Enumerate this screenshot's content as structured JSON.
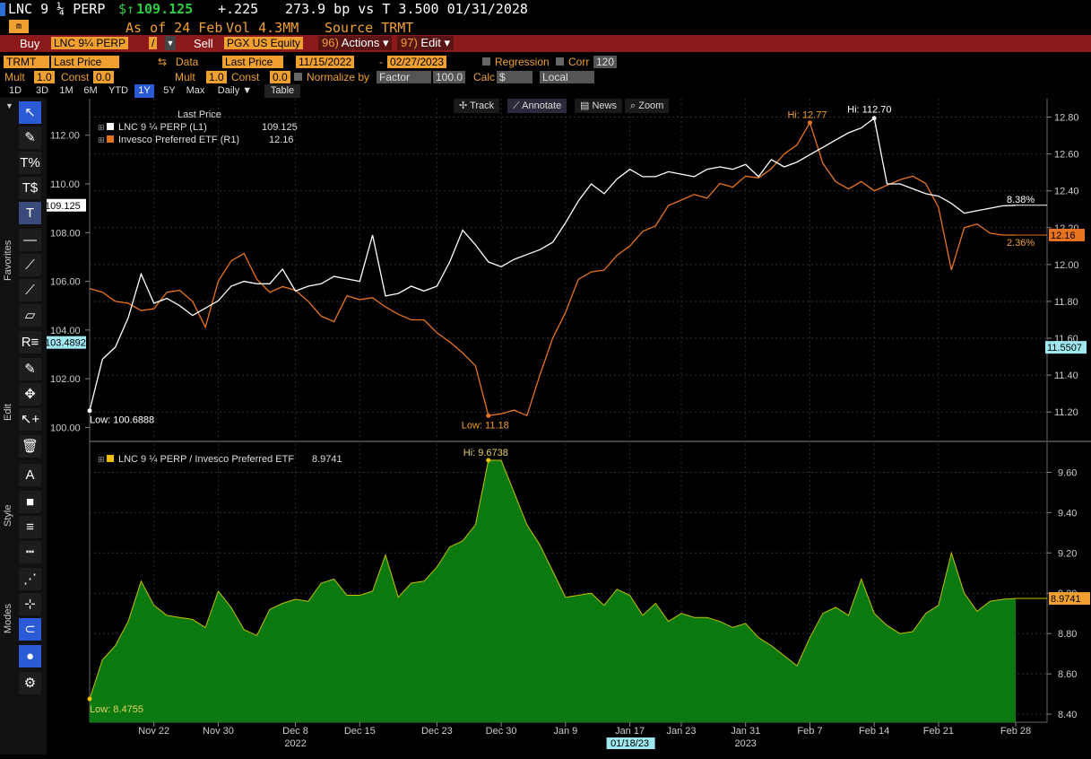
{
  "header": {
    "ticker": "LNC 9 ¼ PERP",
    "currency_symbol": "$",
    "up_arrow": "↑",
    "price": "109.125",
    "change": "+.225",
    "spread": "273.9 bp vs T 3.500 01/31/2028",
    "as_of": "As of 24 Feb",
    "volume": "Vol 4.3MM",
    "source": "Source TRMT"
  },
  "action_bar": {
    "buy_label": "Buy",
    "buy_ticker": "LNC 9¼ PERP",
    "slash": "/",
    "sell_label": "Sell",
    "sell_ticker": "PGX US Equity",
    "actions_num": "96)",
    "actions_label": "Actions",
    "edit_num": "97)",
    "edit_label": "Edit"
  },
  "controls": {
    "source_field": "TRMT",
    "series_field": "Last Price",
    "data_label": "Data",
    "data_field": "Last Price",
    "start_date": "11/15/2022",
    "dash": "-",
    "end_date": "02/27/2023",
    "regression_label": "Regression",
    "corr_label": "Corr",
    "corr_value": "120",
    "mult_label": "Mult",
    "mult_value": "1.0",
    "const_label": "Const",
    "const_value": "0.0",
    "mult2_label": "Mult",
    "mult2_value": "1.0",
    "const2_label": "Const",
    "const2_value": "0.0",
    "normalize_label": "Normalize by",
    "normalize_field": "Factor",
    "normalize_value": "100.0",
    "calc_label": "Calc",
    "calc_field": "$",
    "local_field": "Local"
  },
  "period_tabs": [
    "1D",
    "3D",
    "1M",
    "6M",
    "YTD",
    "1Y",
    "5Y",
    "Max",
    "Daily ▼",
    "Table"
  ],
  "active_tab": "1Y",
  "chart_tools": [
    "Track",
    "Annotate",
    "News",
    "Zoom"
  ],
  "sidebar_labels": {
    "favorites": "Favorites",
    "edit": "Edit",
    "style": "Style",
    "modes": "Modes"
  },
  "sidebar_tools": [
    {
      "name": "cursor-icon",
      "glyph": "↖"
    },
    {
      "name": "pencil-line-icon",
      "glyph": "✎"
    },
    {
      "name": "percent-tool-icon",
      "glyph": "T%"
    },
    {
      "name": "dollar-tool-icon",
      "glyph": "T$"
    },
    {
      "name": "text-tool-icon",
      "glyph": "T"
    },
    {
      "name": "horizontal-line-icon",
      "glyph": "—"
    },
    {
      "name": "trend-line-icon",
      "glyph": "⟋"
    },
    {
      "name": "ray-line-icon",
      "glyph": "⟋"
    },
    {
      "name": "channel-icon",
      "glyph": "▱"
    },
    {
      "name": "regression-icon",
      "glyph": "R≡"
    },
    {
      "name": "draw-pencil-icon",
      "glyph": "✎"
    },
    {
      "name": "move-icon",
      "glyph": "✥"
    },
    {
      "name": "select-add-icon",
      "glyph": "↖+"
    },
    {
      "name": "trash-icon",
      "glyph": "🗑"
    },
    {
      "name": "font-style-icon",
      "glyph": "A"
    },
    {
      "name": "fill-color-icon",
      "glyph": "■"
    },
    {
      "name": "line-weight-icon",
      "glyph": "≡"
    },
    {
      "name": "line-style-icon",
      "glyph": "┅"
    },
    {
      "name": "dotted-mode-icon",
      "glyph": "⋰"
    },
    {
      "name": "snap-mode-icon",
      "glyph": "⊹"
    },
    {
      "name": "magnet-icon",
      "glyph": "⊂"
    },
    {
      "name": "color-mode-icon",
      "glyph": "●"
    },
    {
      "name": "settings-icon",
      "glyph": "⚙"
    }
  ],
  "colors": {
    "white_series": "#ffffff",
    "orange_series": "#e8731e",
    "ratio_fill": "#0a7a10",
    "ratio_line": "#c8c000",
    "hi_orange": "#f0a030",
    "redbar": "#8c1a1a"
  },
  "chart_data": [
    {
      "type": "line",
      "legend_title": "Last Price",
      "series": [
        {
          "name": "LNC 9 ¼ PERP (L1)",
          "last": "109.125",
          "axis": "left",
          "x_index": [
            0,
            1,
            2,
            3,
            4,
            5,
            6,
            7,
            8,
            9,
            10,
            11,
            12,
            13,
            14,
            15,
            16,
            17,
            18,
            19,
            20,
            21,
            22,
            23,
            24,
            25,
            26,
            27,
            28,
            29,
            30,
            31,
            32,
            33,
            34,
            35,
            36,
            37,
            38,
            39,
            40,
            41,
            42,
            43,
            44,
            45,
            46,
            47,
            48,
            49,
            50,
            51,
            52,
            53,
            54,
            55,
            56,
            57,
            58,
            59,
            60,
            61,
            62,
            63,
            64,
            65,
            66,
            67,
            68,
            69,
            70,
            71,
            72
          ],
          "values": [
            100.69,
            102.8,
            103.3,
            104.5,
            106.3,
            105.1,
            105.3,
            105.0,
            104.6,
            104.9,
            105.2,
            105.8,
            106.0,
            105.9,
            105.9,
            106.5,
            105.6,
            105.8,
            105.9,
            106.2,
            106.1,
            106.0,
            107.9,
            105.4,
            105.5,
            105.8,
            105.6,
            105.8,
            106.8,
            108.1,
            107.5,
            106.8,
            106.6,
            106.9,
            107.1,
            107.3,
            107.6,
            108.4,
            109.3,
            110.0,
            109.6,
            110.2,
            110.6,
            110.3,
            110.3,
            110.5,
            110.4,
            110.3,
            110.6,
            110.7,
            110.6,
            110.8,
            110.3,
            111.0,
            110.7,
            110.9,
            111.2,
            111.5,
            111.8,
            112.1,
            112.3,
            112.7,
            110.0,
            110.0,
            109.8,
            109.6,
            109.5,
            109.2,
            108.8,
            108.9,
            109.0,
            109.1,
            109.125
          ],
          "lo_label": "Low: 100.6888",
          "hi_label": "Hi: 112.70",
          "pct_label": "8.38%"
        },
        {
          "name": "Invesco Preferred ETF (R1)",
          "last": "12.16",
          "axis": "right",
          "values": [
            11.87,
            11.85,
            11.8,
            11.79,
            11.75,
            11.76,
            11.85,
            11.86,
            11.8,
            11.66,
            11.91,
            12.02,
            12.06,
            11.92,
            11.85,
            11.88,
            11.86,
            11.8,
            11.72,
            11.69,
            11.83,
            11.81,
            11.82,
            11.77,
            11.73,
            11.7,
            11.7,
            11.63,
            11.58,
            11.52,
            11.45,
            11.18,
            11.19,
            11.21,
            11.18,
            11.4,
            11.6,
            11.74,
            11.92,
            11.96,
            11.97,
            12.05,
            12.1,
            12.18,
            12.21,
            12.32,
            12.35,
            12.38,
            12.36,
            12.44,
            12.42,
            12.48,
            12.47,
            12.52,
            12.6,
            12.65,
            12.77,
            12.55,
            12.45,
            12.41,
            12.45,
            12.4,
            12.43,
            12.46,
            12.48,
            12.44,
            12.31,
            11.97,
            12.2,
            12.22,
            12.17,
            12.16,
            12.16
          ],
          "lo_label": "Low: 11.18",
          "hi_label": "Hi: 12.77",
          "pct_label": "2.36%"
        }
      ],
      "left_ylim": [
        99.5,
        113.5
      ],
      "right_ylim": [
        11.05,
        12.9
      ],
      "left_ticks": [
        "112.00",
        "110.00",
        "108.00",
        "106.00",
        "104.00",
        "102.00",
        "100.00"
      ],
      "right_ticks": [
        "12.80",
        "12.60",
        "12.40",
        "12.20",
        "12.00",
        "11.80",
        "11.60",
        "11.40",
        "11.20"
      ],
      "left_ticks_v": [
        112,
        110,
        108,
        106,
        104,
        102,
        100
      ],
      "right_ticks_v": [
        12.8,
        12.6,
        12.4,
        12.2,
        12.0,
        11.8,
        11.6,
        11.4,
        11.2
      ],
      "left_cursor_tag": "109.125",
      "left_low_tag": "103.4892",
      "right_cursor_tag": "12.16",
      "right_low_tag": "11.5507"
    },
    {
      "type": "area",
      "series": [
        {
          "name": "LNC 9 ¼ PERP / Invesco Preferred ETF",
          "last": "8.9741",
          "values": [
            8.4755,
            8.67,
            8.74,
            8.86,
            9.06,
            8.94,
            8.89,
            8.88,
            8.87,
            8.83,
            9.01,
            8.93,
            8.82,
            8.79,
            8.92,
            8.95,
            8.97,
            8.96,
            9.05,
            9.07,
            8.99,
            8.99,
            9.01,
            9.19,
            8.98,
            9.05,
            9.06,
            9.13,
            9.23,
            9.26,
            9.34,
            9.66,
            9.66,
            9.5,
            9.34,
            9.24,
            9.11,
            8.98,
            8.99,
            9.0,
            8.94,
            9.02,
            8.99,
            8.89,
            8.95,
            8.86,
            8.9,
            8.88,
            8.88,
            8.86,
            8.83,
            8.85,
            8.78,
            8.74,
            8.69,
            8.64,
            8.78,
            8.9,
            8.93,
            8.89,
            9.07,
            8.9,
            8.84,
            8.8,
            8.81,
            8.9,
            8.94,
            9.2,
            9.0,
            8.91,
            8.96,
            8.97,
            8.9741
          ],
          "lo_label": "Low: 8.4755",
          "hi_label": "Hi: 9.6738"
        }
      ],
      "ylim": [
        8.36,
        9.74
      ],
      "ticks": [
        "9.60",
        "9.40",
        "9.20",
        "9.00",
        "8.80",
        "8.60",
        "8.40"
      ],
      "ticks_v": [
        9.6,
        9.4,
        9.2,
        9.0,
        8.8,
        8.6,
        8.4
      ],
      "cursor_tag": "8.9741"
    }
  ],
  "x_axis": {
    "labels": [
      "Nov 22",
      "Nov 30",
      "Dec 8",
      "Dec 15",
      "Dec 23",
      "Dec 30",
      "Jan 9",
      "Jan 17",
      "Jan 23",
      "Jan 31",
      "Feb 7",
      "Feb 14",
      "Feb 21",
      "Feb 28"
    ],
    "label_index": [
      5,
      10,
      16,
      21,
      27,
      32,
      37,
      42,
      46,
      51,
      56,
      61,
      66,
      72
    ],
    "years": [
      "2022",
      "2023"
    ],
    "year_index": [
      16,
      51
    ],
    "cursor_date": "01/18/23",
    "cursor_index": 42
  }
}
